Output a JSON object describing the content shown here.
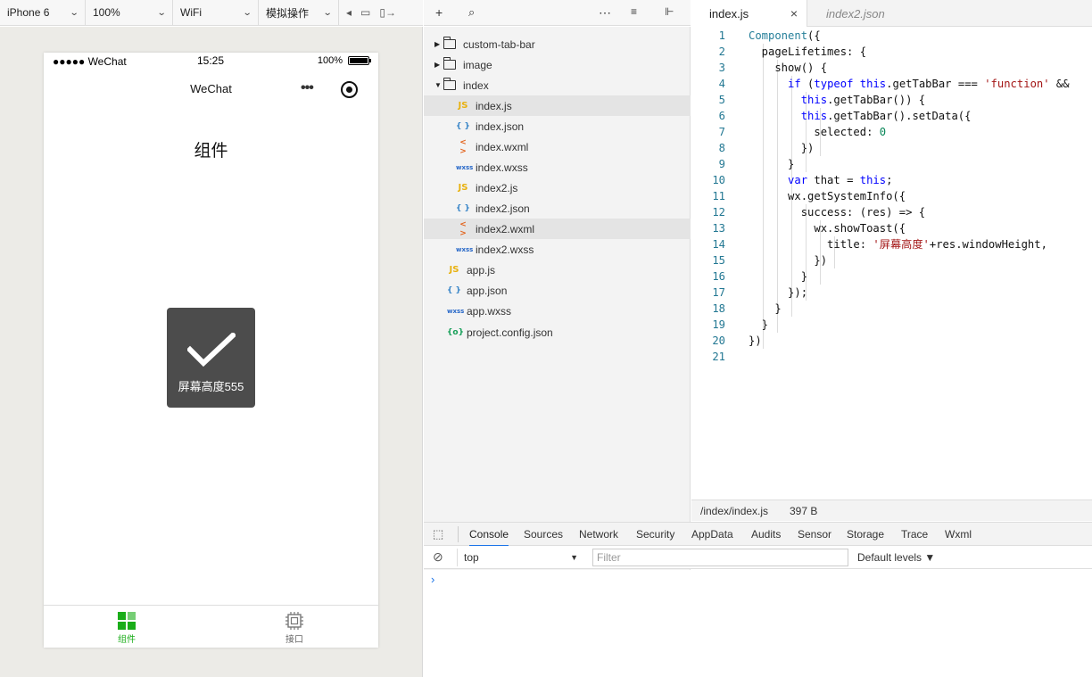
{
  "toolbar": {
    "device": "iPhone 6",
    "zoom": "100%",
    "network": "WiFi",
    "operation": "模拟操作"
  },
  "phone": {
    "status_left": "●●●●● WeChat",
    "time": "15:25",
    "battery": "100%",
    "battery_level": 1.0,
    "nav_title": "WeChat",
    "nav_menu": "•••",
    "heading": "组件",
    "toast_text": "屏幕高度555",
    "tabs": [
      {
        "label": "组件",
        "icon": "components-icon",
        "color": "#1aad19"
      },
      {
        "label": "接口",
        "icon": "api-chip-icon",
        "color": "#666666"
      }
    ]
  },
  "file_tree": [
    {
      "name": "custom-tab-bar",
      "type": "folder",
      "expanded": false
    },
    {
      "name": "image",
      "type": "folder",
      "expanded": false
    },
    {
      "name": "index",
      "type": "folder",
      "expanded": true
    },
    {
      "name": "index.js",
      "type": "js",
      "icon": "JS"
    },
    {
      "name": "index.json",
      "type": "json",
      "icon": "{ }"
    },
    {
      "name": "index.wxml",
      "type": "wxml",
      "icon": "< >"
    },
    {
      "name": "index.wxss",
      "type": "wxss",
      "icon": "wxss"
    },
    {
      "name": "index2.js",
      "type": "js",
      "icon": "JS"
    },
    {
      "name": "index2.json",
      "type": "json",
      "icon": "{ }"
    },
    {
      "name": "index2.wxml",
      "type": "wxml",
      "icon": "< >"
    },
    {
      "name": "index2.wxss",
      "type": "wxss",
      "icon": "wxss"
    },
    {
      "name": "app.js",
      "type": "js",
      "icon": "JS"
    },
    {
      "name": "app.json",
      "type": "json",
      "icon": "{ }"
    },
    {
      "name": "app.wxss",
      "type": "wxss",
      "icon": "wxss"
    },
    {
      "name": "project.config.json",
      "type": "cfg",
      "icon": "{o}"
    }
  ],
  "editor": {
    "tabs": [
      "index.js",
      "index2.json"
    ],
    "close": "×",
    "lines": [
      "Component({",
      "  pageLifetimes: {",
      "    show() {",
      "      if (typeof this.getTabBar === 'function' &&",
      "        this.getTabBar()) {",
      "        this.getTabBar().setData({",
      "          selected: 0",
      "        })",
      "      }",
      "      var that = this;",
      "      wx.getSystemInfo({",
      "        success: (res) => {",
      "          wx.showToast({",
      "            title: '屏幕高度'+res.windowHeight,",
      "          })",
      "        }",
      "      });",
      "    }",
      "  }",
      "})",
      ""
    ],
    "status_path": "/index/index.js",
    "status_size": "397 B"
  },
  "devtools": {
    "tabs": [
      "Console",
      "Sources",
      "Network",
      "Security",
      "AppData",
      "Audits",
      "Sensor",
      "Storage",
      "Trace",
      "Wxml"
    ],
    "context": "top",
    "filter_placeholder": "Filter",
    "levels": "Default levels ▼",
    "prompt": "›"
  }
}
